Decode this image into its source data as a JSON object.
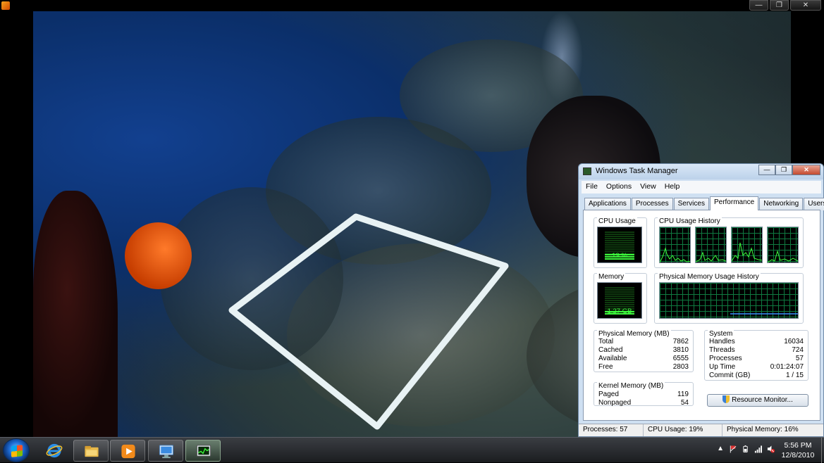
{
  "player": {
    "window_buttons": {
      "minimize": "—",
      "restore": "❐",
      "close": "✕"
    }
  },
  "task_manager": {
    "title": "Windows Task Manager",
    "window_buttons": {
      "minimize": "—",
      "restore": "❐",
      "close": "✕"
    },
    "menu": [
      "File",
      "Options",
      "View",
      "Help"
    ],
    "tabs": [
      "Applications",
      "Processes",
      "Services",
      "Performance",
      "Networking",
      "Users"
    ],
    "active_tab": "Performance",
    "cpu_usage": {
      "label": "CPU Usage",
      "value_text": "19 %",
      "percent": 19
    },
    "cpu_history": {
      "label": "CPU Usage History",
      "cores": 4
    },
    "memory": {
      "label": "Memory",
      "value_text": "1.27 GB",
      "percent": 16
    },
    "memory_history": {
      "label": "Physical Memory Usage History"
    },
    "physical_memory": {
      "label": "Physical Memory (MB)",
      "rows": [
        {
          "name": "Total",
          "value": "7862"
        },
        {
          "name": "Cached",
          "value": "3810"
        },
        {
          "name": "Available",
          "value": "6555"
        },
        {
          "name": "Free",
          "value": "2803"
        }
      ]
    },
    "kernel_memory": {
      "label": "Kernel Memory (MB)",
      "rows": [
        {
          "name": "Paged",
          "value": "119"
        },
        {
          "name": "Nonpaged",
          "value": "54"
        }
      ]
    },
    "system": {
      "label": "System",
      "rows": [
        {
          "name": "Handles",
          "value": "16034"
        },
        {
          "name": "Threads",
          "value": "724"
        },
        {
          "name": "Processes",
          "value": "57"
        },
        {
          "name": "Up Time",
          "value": "0:01:24:07"
        },
        {
          "name": "Commit (GB)",
          "value": "1 / 15"
        }
      ]
    },
    "resource_monitor_button": "Resource Monitor...",
    "status": {
      "processes": "Processes: 57",
      "cpu": "CPU Usage: 19%",
      "memory": "Physical Memory: 16%"
    }
  },
  "taskbar": {
    "pinned": [
      "ie-icon",
      "explorer-icon",
      "media-player-icon",
      "remote-desktop-icon",
      "task-manager-icon"
    ],
    "tray_icons": [
      "show-hidden-icons",
      "action-center-flag-icon",
      "power-icon",
      "network-icon",
      "volume-muted-icon"
    ],
    "clock": {
      "time": "5:56 PM",
      "date": "12/8/2010"
    }
  },
  "colors": {
    "graph_line": "#3dfb3d",
    "graph_grid": "#0f7a40",
    "memory_line": "#3a8cff"
  }
}
